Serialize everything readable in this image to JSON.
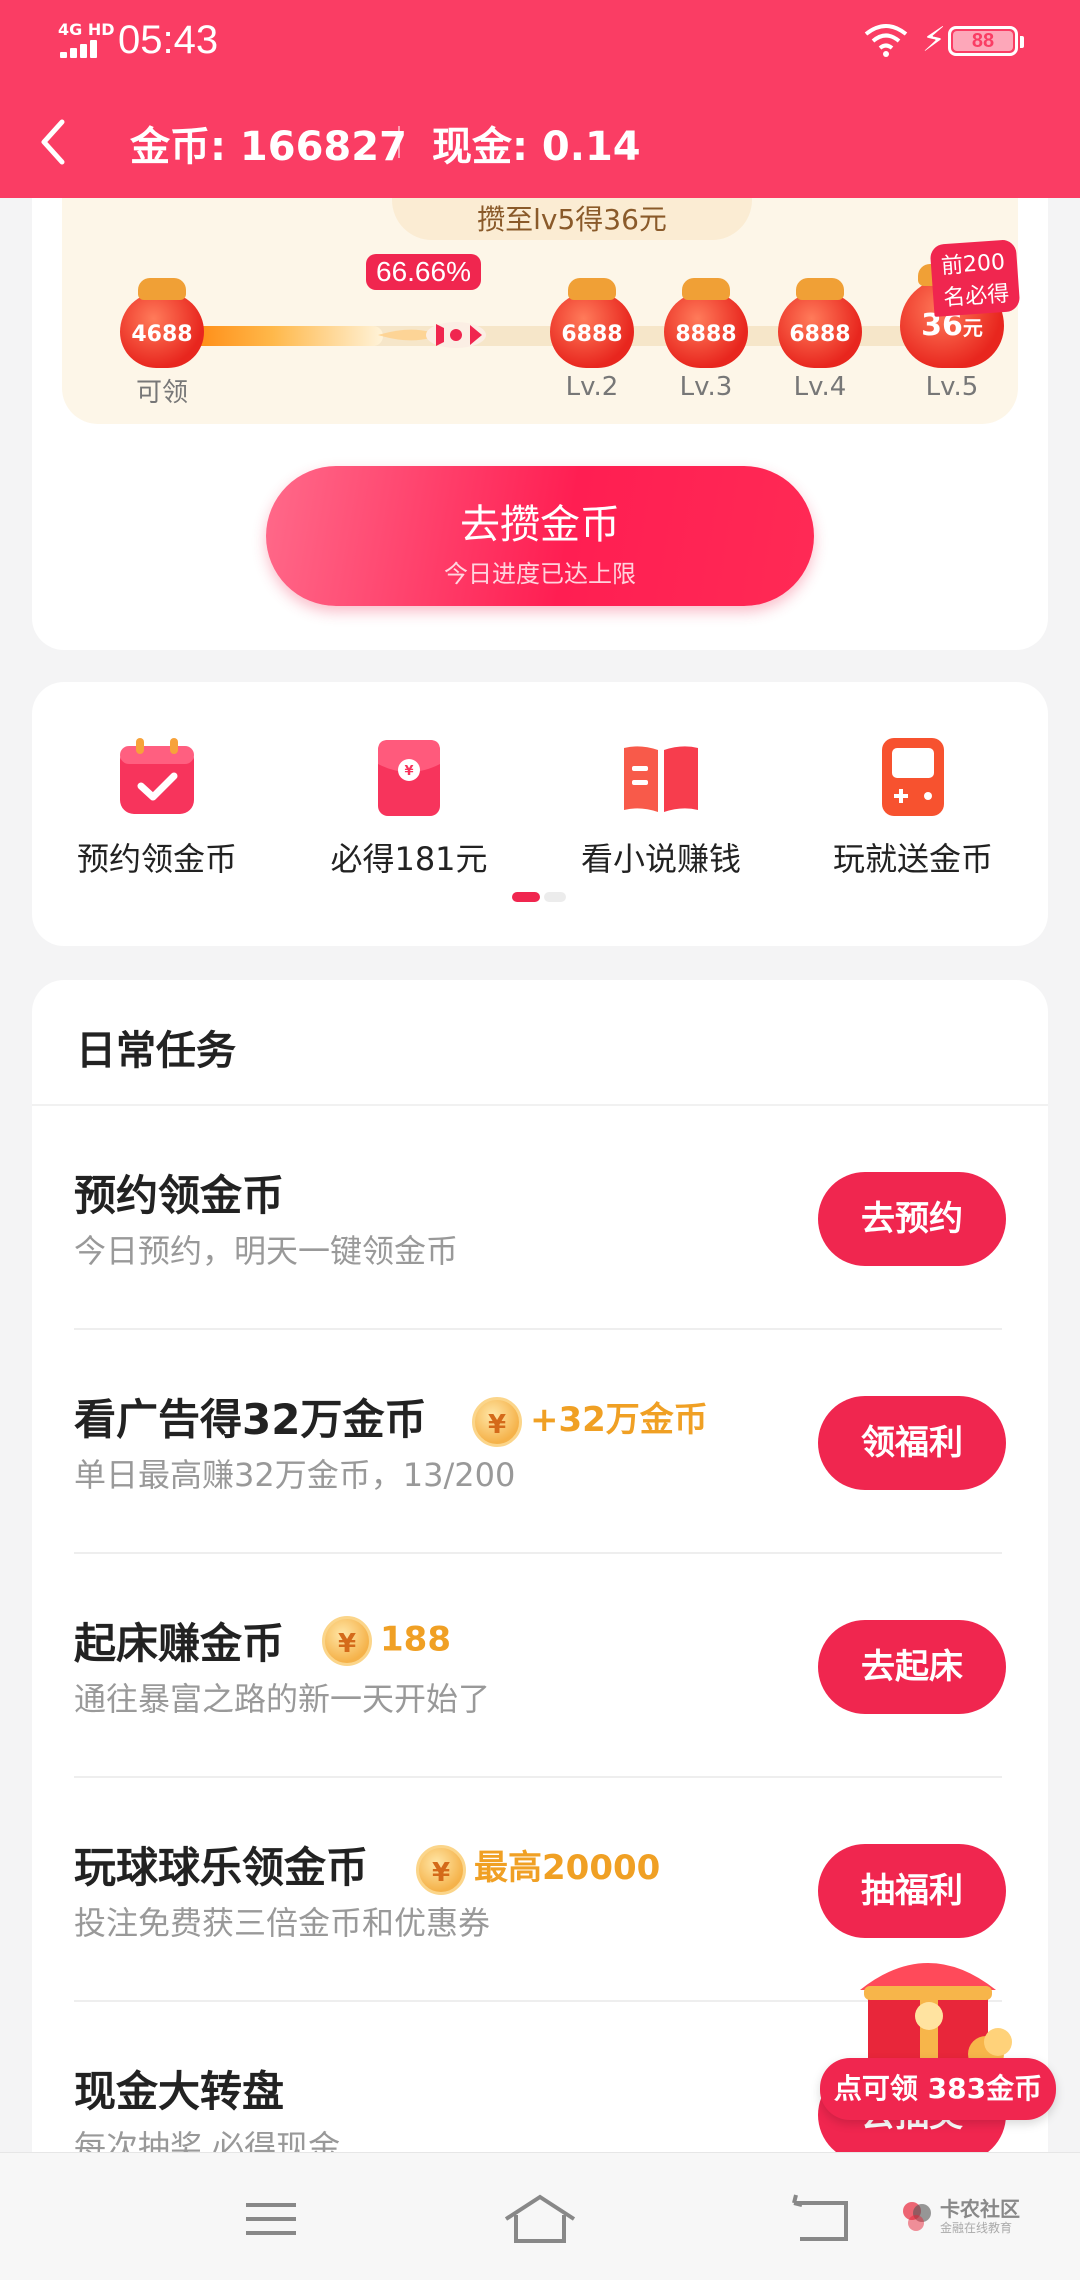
{
  "status": {
    "network": "4G HD",
    "time": "05:43",
    "battery": "88"
  },
  "header": {
    "coins_label": "金币: 166827",
    "cash_label": "现金: 0.14"
  },
  "progress": {
    "goal_text": "攒至lv5得36元",
    "percent_text": "66.66%",
    "percent_value": 0.6666,
    "top200_text": "前200名必得",
    "levels": [
      {
        "amount": "4688",
        "label": "可领"
      },
      {
        "amount": "6888",
        "label": "Lv.2"
      },
      {
        "amount": "8888",
        "label": "Lv.3"
      },
      {
        "amount": "6888",
        "label": "Lv.4"
      },
      {
        "amount": "36",
        "unit": "元",
        "label": "Lv.5"
      }
    ],
    "main_button": "去攒金币",
    "main_button_sub": "今日进度已达上限"
  },
  "shortcuts": [
    {
      "label": "预约领金币",
      "icon": "calendar-check-icon"
    },
    {
      "label": "必得181元",
      "icon": "red-envelope-icon"
    },
    {
      "label": "看小说赚钱",
      "icon": "book-icon"
    },
    {
      "label": "玩就送金币",
      "icon": "game-console-icon"
    }
  ],
  "daily": {
    "title": "日常任务",
    "tasks": [
      {
        "name": "预约领金币",
        "sub": "今日预约，明天一键领金币",
        "badge": "",
        "button": "去预约"
      },
      {
        "name": "看广告得32万金币",
        "sub": "单日最高赚32万金币，13/200",
        "badge": "+32万金币",
        "button": "领福利"
      },
      {
        "name": "起床赚金币",
        "sub": "通往暴富之路的新一天开始了",
        "badge": "188",
        "button": "去起床"
      },
      {
        "name": "玩球球乐领金币",
        "sub": "投注免费获三倍金币和优惠券",
        "badge": "最高20000",
        "button": "抽福利"
      },
      {
        "name": "现金大转盘",
        "sub": "每次抽奖 必得现金",
        "badge": "",
        "button": "去抽奖"
      }
    ]
  },
  "gift": {
    "label": "点可领 383金币"
  },
  "watermark": {
    "title": "卡农社区",
    "sub": "金融在线教育"
  },
  "colors": {
    "accent": "#fa3d64",
    "button": "#f0264f",
    "coin_gold": "#f0a024"
  }
}
